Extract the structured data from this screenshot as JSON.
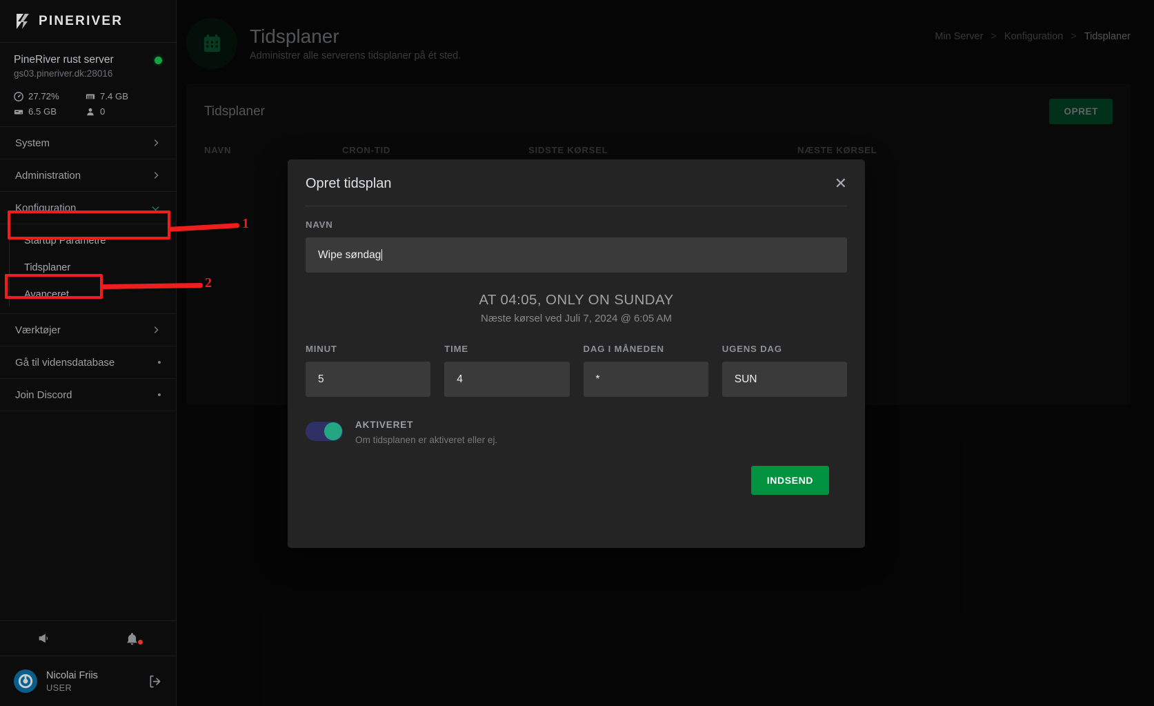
{
  "brand": {
    "name": "PINERIVER",
    "logo_icon": "pineriver-logo-icon"
  },
  "server": {
    "name": "PineRiver rust server",
    "host": "gs03.pineriver.dk:28016",
    "status_icon": "status-dot-online",
    "stats": [
      {
        "icon": "cpu-gauge-icon",
        "value": "27.72%"
      },
      {
        "icon": "memory-icon",
        "value": "7.4 GB"
      },
      {
        "icon": "disk-icon",
        "value": "6.5 GB"
      },
      {
        "icon": "players-icon",
        "value": "0"
      }
    ]
  },
  "sidebar": {
    "items": [
      {
        "label": "System",
        "trailing": "chevron-right-icon"
      },
      {
        "label": "Administration",
        "trailing": "chevron-right-icon"
      },
      {
        "label": "Konfiguration",
        "trailing": "chevron-down-icon"
      },
      {
        "label": "Værktøjer",
        "trailing": "chevron-right-icon"
      },
      {
        "label": "Gå til vidensdatabase",
        "trailing": "dot-icon"
      },
      {
        "label": "Join Discord",
        "trailing": "dot-icon"
      }
    ],
    "subitems": [
      {
        "label": "Startup Parametre"
      },
      {
        "label": "Tidsplaner"
      },
      {
        "label": "Avanceret"
      }
    ],
    "footer_icons": [
      {
        "icon": "megaphone-icon"
      },
      {
        "icon": "bell-icon"
      }
    ],
    "user": {
      "name": "Nicolai Friis",
      "role": "USER",
      "avatar_icon": "user-avatar",
      "logout_icon": "logout-icon"
    }
  },
  "header": {
    "icon": "calendar-icon",
    "title": "Tidsplaner",
    "subtitle": "Administrer alle serverens tidsplaner på ét sted."
  },
  "breadcrumbs": [
    {
      "label": "Min Server",
      "current": false
    },
    {
      "label": "Konfiguration",
      "current": false
    },
    {
      "label": "Tidsplaner",
      "current": true
    }
  ],
  "breadcrumb_separator": ">",
  "content_card": {
    "title": "Tidsplaner",
    "create_button": "OPRET",
    "columns": [
      "NAVN",
      "CRON-TID",
      "SIDSTE KØRSEL",
      "NÆSTE KØRSEL"
    ]
  },
  "modal": {
    "title": "Opret tidsplan",
    "close_icon": "close-icon",
    "name_label": "NAVN",
    "name_value": "Wipe søndag",
    "name_placeholder": "",
    "cron_summary": "AT 04:05, ONLY ON SUNDAY",
    "cron_next_run": "Næste kørsel ved Juli 7, 2024 @ 6:05 AM",
    "cron_fields": [
      {
        "label": "MINUT",
        "value": "5"
      },
      {
        "label": "TIME",
        "value": "4"
      },
      {
        "label": "DAG I MÅNEDEN",
        "value": "*"
      },
      {
        "label": "UGENS DAG",
        "value": "SUN"
      }
    ],
    "toggle": {
      "label": "AKTIVERET",
      "help": "Om tidsplanen er aktiveret eller ej.",
      "state": "on"
    },
    "submit_button": "INDSEND"
  },
  "annotations": [
    {
      "number": "1",
      "target": "Konfiguration"
    },
    {
      "number": "2",
      "target": "Tidsplaner"
    }
  ],
  "colors": {
    "accent_green": "#00923f",
    "create_green": "#00693a",
    "annotation_red": "#f01d1d",
    "toggle_on": "#25a683",
    "status_online": "#14a340"
  }
}
